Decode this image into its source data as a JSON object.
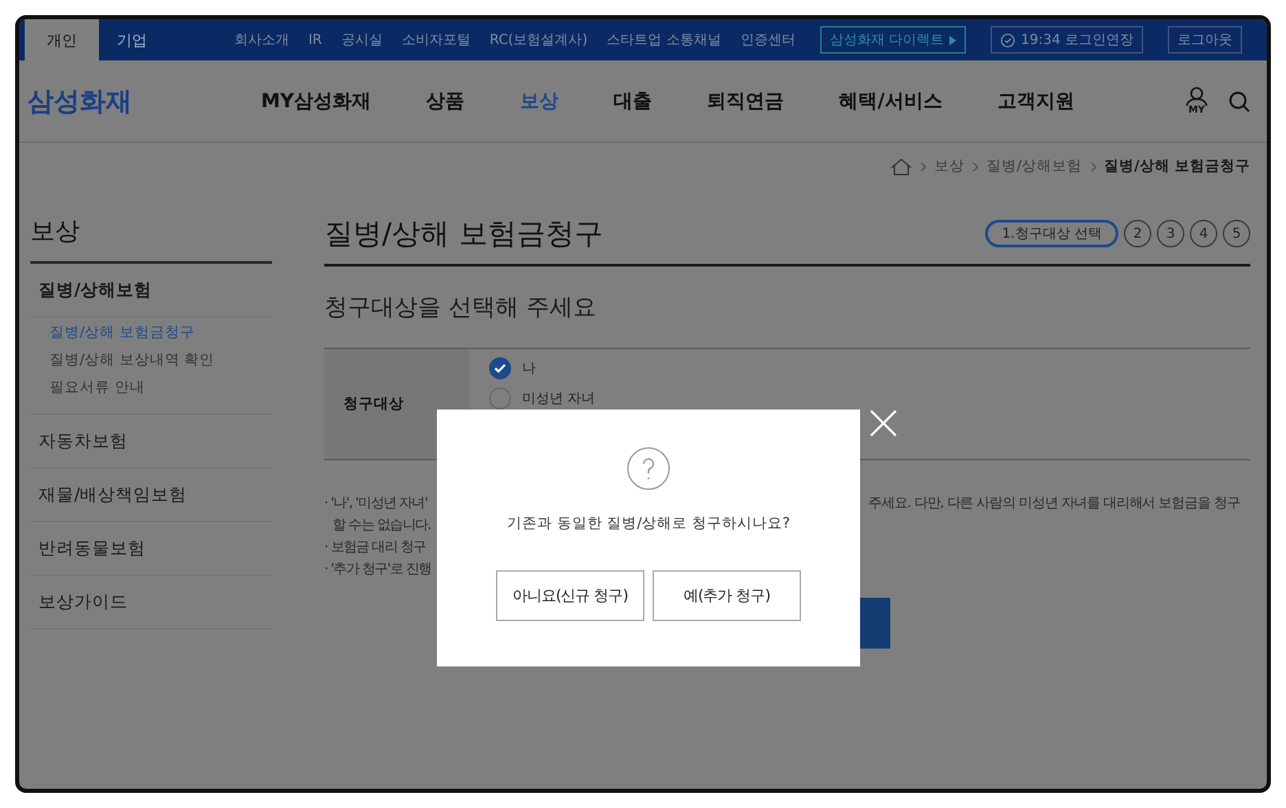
{
  "top_bar": {
    "tabs": [
      {
        "label": "개인",
        "selected": true
      },
      {
        "label": "기업",
        "selected": false
      }
    ],
    "links": [
      "회사소개",
      "IR",
      "공시실",
      "소비자포털",
      "RC(보험설계사)",
      "스타트업 소통채널",
      "인증센터"
    ],
    "direct_button": "삼성화재 다이렉트",
    "session_button": "19:34 로그인연장",
    "logout_button": "로그아웃"
  },
  "header": {
    "logo": "삼성화재",
    "nav": [
      {
        "label": "MY삼성화재",
        "selected": false
      },
      {
        "label": "상품",
        "selected": false
      },
      {
        "label": "보상",
        "selected": true
      },
      {
        "label": "대출",
        "selected": false
      },
      {
        "label": "퇴직연금",
        "selected": false
      },
      {
        "label": "혜택/서비스",
        "selected": false
      },
      {
        "label": "고객지원",
        "selected": false
      }
    ],
    "my_label": "MY"
  },
  "breadcrumb": [
    "보상",
    "질병/상해보험",
    "질병/상해 보험금청구"
  ],
  "sidebar": {
    "title": "보상",
    "sections": [
      {
        "label": "질병/상해보험",
        "expanded": true,
        "children": [
          {
            "label": "질병/상해 보험금청구",
            "selected": true
          },
          {
            "label": "질병/상해 보상내역 확인",
            "selected": false
          },
          {
            "label": "필요서류 안내",
            "selected": false
          }
        ]
      },
      {
        "label": "자동차보험",
        "expanded": false
      },
      {
        "label": "재물/배상책임보험",
        "expanded": false
      },
      {
        "label": "반려동물보험",
        "expanded": false
      },
      {
        "label": "보상가이드",
        "expanded": false
      }
    ]
  },
  "page": {
    "title": "질병/상해 보험금청구",
    "steps": [
      {
        "label": "1.청구대상 선택",
        "selected": true
      },
      {
        "label": "2",
        "selected": false
      },
      {
        "label": "3",
        "selected": false
      },
      {
        "label": "4",
        "selected": false
      },
      {
        "label": "5",
        "selected": false
      }
    ],
    "subtitle": "청구대상을 선택해 주세요",
    "form": {
      "label": "청구대상",
      "options": [
        {
          "label": "나",
          "selected": true
        },
        {
          "label": "미성년 자녀",
          "selected": false
        }
      ]
    },
    "notes": [
      {
        "text": "· '나', '미성년 자녀'",
        "rest": "주세요. 다만, 다른 사람의 미성년 자녀를 대리해서 보험금을 청구"
      },
      {
        "text": "할 수는 없습니다."
      },
      {
        "text": "· 보험금 대리 청구"
      },
      {
        "text": "· '추가 청구'로 진행"
      }
    ]
  },
  "dialog": {
    "message": "기존과 동일한 질병/상해로 청구하시나요?",
    "buttons": [
      "아니요(신규 청구)",
      "예(추가 청구)"
    ]
  }
}
